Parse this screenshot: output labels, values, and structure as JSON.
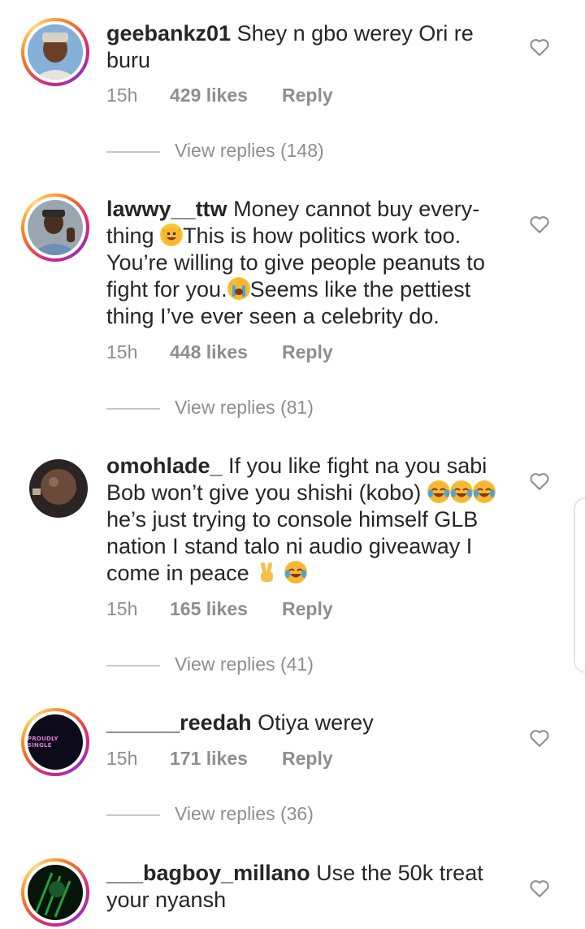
{
  "comments": [
    {
      "username": "geebankz01",
      "text": "Shey n gbo werey Ori re buru",
      "time": "15h",
      "likes": "429 likes",
      "reply": "Reply",
      "view_replies": "View replies (148)",
      "avatar_icon": "user-photo"
    },
    {
      "username": "lawwy__ttw",
      "text_parts": [
        "Money cannot buy every-thing ",
        "This is how politics work too. You’re willing to give people peanuts to fight for  you.",
        "Seems like the pettiest thing I’ve ever seen a celebrity do."
      ],
      "time": "15h",
      "likes": "448 likes",
      "reply": "Reply",
      "view_replies": "View replies (81)",
      "emoji_icons": [
        "grinning-cat-emoji",
        "loudly-crying-emoji"
      ]
    },
    {
      "username": "omohlade_",
      "text_parts": [
        "If you like fight na you sabi Bob won’t give you shishi (kobo) ",
        " he’s just trying to console himself GLB nation I stand talo ni audio giveaway  I come in peace ",
        " "
      ],
      "time": "15h",
      "likes": "165 likes",
      "reply": "Reply",
      "view_replies": "View replies (41)",
      "emoji_icons": [
        "tears-of-joy-emoji",
        "victory-hand-emoji"
      ]
    },
    {
      "username": "______reedah",
      "text": "Otiya werey",
      "time": "15h",
      "likes": "171 likes",
      "reply": "Reply",
      "view_replies": "View replies (36)",
      "avatar_text": "PROUDLY SINGLE"
    },
    {
      "username": "___bagboy_millano",
      "text": "Use the 50k treat your nyansh"
    }
  ],
  "colors": {
    "text": "#262626",
    "meta": "#8e8e8e",
    "ring_start": "#d62976",
    "ring_end": "#fa7e1e"
  },
  "icons": {
    "like": "heart-outline-icon"
  }
}
